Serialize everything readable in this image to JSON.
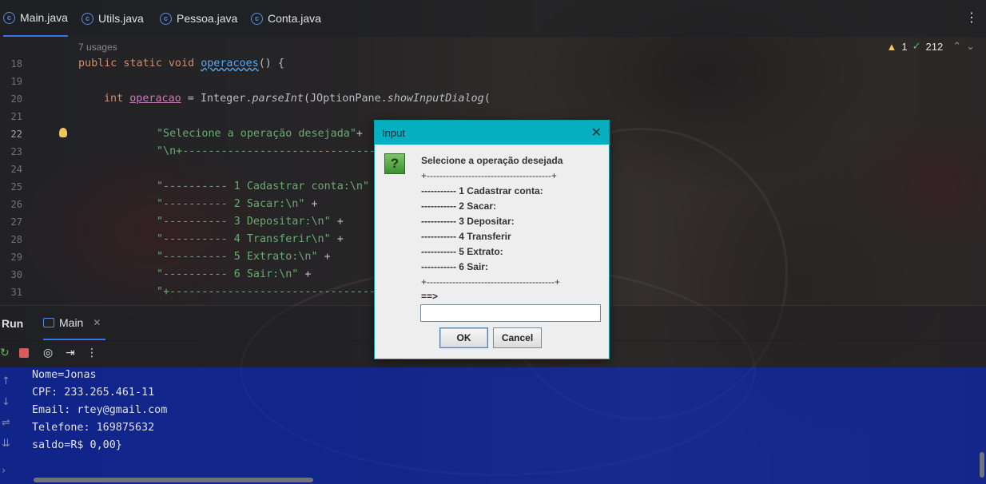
{
  "tabs": [
    {
      "label": "Main.java",
      "active": true
    },
    {
      "label": "Utils.java",
      "active": false
    },
    {
      "label": "Pessoa.java",
      "active": false
    },
    {
      "label": "Conta.java",
      "active": false
    }
  ],
  "editor": {
    "usages": "7 usages",
    "inspection": {
      "warnings": "1",
      "checks": "212"
    },
    "line_numbers": [
      "18",
      "19",
      "20",
      "21",
      "22",
      "23",
      "24",
      "25",
      "26",
      "27",
      "28",
      "29",
      "30",
      "31"
    ],
    "current_line": "22",
    "lines": {
      "l18_kw": "public static void ",
      "l18_fn": "operacoes",
      "l18_rest": "() {",
      "l20_kw": "int ",
      "l20_var": "operacao",
      "l20_a": " = Integer.",
      "l20_parse": "parseInt",
      "l20_b": "(JOptionPane.",
      "l20_show": "showInputDialog",
      "l20_c": "(",
      "l22": "\"Selecione a operação desejada\"",
      "l22_plus": "+",
      "l23": "\"\\n+------------------------------------",
      "l25": "\"---------- 1 Cadastrar conta:\\n\"",
      "l26": "\"---------- 2 Sacar:\\n\"",
      "l27": "\"---------- 3 Depositar:\\n\"",
      "l28": "\"---------- 4 Transferir\\n\"",
      "l29": "\"---------- 5 Extrato:\\n\"",
      "l30": "\"---------- 6 Sair:\\n\"",
      "l31": "\"+------------------------------------",
      "plus": " +"
    }
  },
  "run": {
    "label": "Run",
    "tab": "Main",
    "console": [
      "Nome=Jonas",
      "CPF: 233.265.461-11",
      "Email: rtey@gmail.com",
      "Telefone: 169875632",
      "saldo=R$ 0,00}"
    ]
  },
  "dialog": {
    "title": "Input",
    "message": [
      "Selecione a operação desejada",
      "+---------------------------------------+",
      "----------- 1 Cadastrar conta:",
      "----------- 2 Sacar:",
      "----------- 3 Depositar:",
      "----------- 4 Transferir",
      "----------- 5 Extrato:",
      "----------- 6 Sair:",
      "+----------------------------------------+",
      "==>"
    ],
    "input_value": "",
    "ok_label": "OK",
    "cancel_label": "Cancel"
  }
}
